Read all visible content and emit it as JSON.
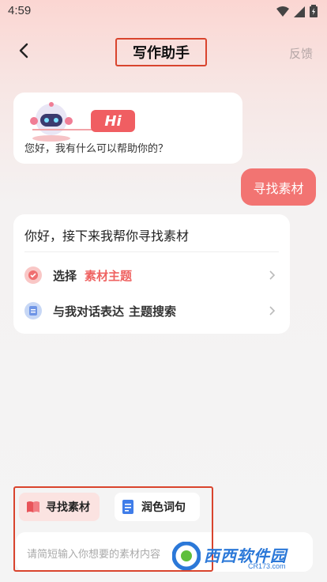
{
  "status_bar": {
    "time": "4:59"
  },
  "header": {
    "title": "写作助手",
    "feedback_label": "反馈"
  },
  "greeting": {
    "badge": "Hi",
    "text": "您好，我有什么可以帮助你的？"
  },
  "user_message": "寻找素材",
  "reply": {
    "heading": "你好，接下来我帮你寻找素材",
    "options": [
      {
        "label": "选择",
        "accent": "素材主题",
        "icon": "check-badge-icon"
      },
      {
        "label": "与我对话表达",
        "tail": "主题搜索",
        "icon": "document-icon"
      }
    ]
  },
  "chips": [
    {
      "label": "寻找素材",
      "icon": "book-icon"
    },
    {
      "label": "润色词句",
      "icon": "note-icon"
    }
  ],
  "input": {
    "placeholder": "请简短输入你想要的素材内容"
  },
  "watermark": {
    "name": "西西软件园",
    "url": "CR173.com"
  },
  "colors": {
    "accent": "#ef6261",
    "highlight_border": "#d9442d",
    "watermark": "#2b78d8"
  }
}
